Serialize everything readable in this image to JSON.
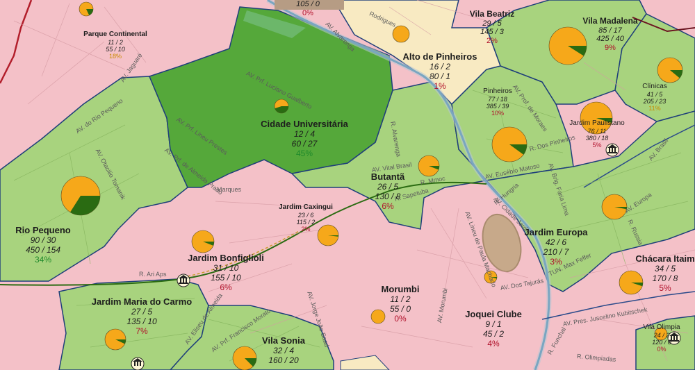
{
  "colors": {
    "pink": "#f4c1c8",
    "light_green": "#a8d37e",
    "dark_green": "#55a83a",
    "cream": "#f8eac2",
    "pie_orange": "#f6a81a",
    "pie_green": "#2a6b12",
    "pct_red": "#b0102a",
    "pct_green": "#1f8a2b",
    "pct_orange": "#c98a00"
  },
  "districts": [
    {
      "name": "Parque Continental",
      "v1": "11 / 2",
      "v2": "55 / 10",
      "pct": "18%",
      "pct_color": "orange"
    },
    {
      "name": "",
      "v1": "105 / 0",
      "v2": "",
      "pct": "0%",
      "pct_color": "red"
    },
    {
      "name": "Vila Beatriz",
      "v1": "29 / 5",
      "v2": "145 / 3",
      "pct": "2%",
      "pct_color": "red"
    },
    {
      "name": "Vila Madalena",
      "v1": "85 / 17",
      "v2": "425 / 40",
      "pct": "9%",
      "pct_color": "red"
    },
    {
      "name": "Alto de Pinheiros",
      "v1": "16 / 2",
      "v2": "80 / 1",
      "pct": "1%",
      "pct_color": "red"
    },
    {
      "name": "Pinheiros",
      "v1": "77 / 18",
      "v2": "385 / 39",
      "pct": "10%",
      "pct_color": "red"
    },
    {
      "name": "Clínicas",
      "v1": "41 / 5",
      "v2": "205 / 23",
      "pct": "11%",
      "pct_color": "orange"
    },
    {
      "name": "Jardim Paulistano",
      "v1": "76 / 11",
      "v2": "380 / 18",
      "pct": "5%",
      "pct_color": "red"
    },
    {
      "name": "Cidade Universitária",
      "v1": "12 / 4",
      "v2": "60 / 27",
      "pct": "45%",
      "pct_color": "green"
    },
    {
      "name": "Butantã",
      "v1": "26 / 5",
      "v2": "130 / 8",
      "pct": "6%",
      "pct_color": "red"
    },
    {
      "name": "Rio Pequeno",
      "v1": "90 / 30",
      "v2": "450 / 154",
      "pct": "34%",
      "pct_color": "green"
    },
    {
      "name": "Jardim Caxingui",
      "v1": "23 / 6",
      "v2": "115 / 2",
      "pct": "2%",
      "pct_color": "red"
    },
    {
      "name": "Jardim Bonfiglioli",
      "v1": "31 / 10",
      "v2": "155 / 10",
      "pct": "6%",
      "pct_color": "red"
    },
    {
      "name": "Jardim Europa",
      "v1": "42 / 6",
      "v2": "210 / 7",
      "pct": "3%",
      "pct_color": "red"
    },
    {
      "name": "Chácara Itaim",
      "v1": "34 / 5",
      "v2": "170 / 8",
      "pct": "5%",
      "pct_color": "red"
    },
    {
      "name": "Jardim Maria do Carmo",
      "v1": "27 / 5",
      "v2": "135 / 10",
      "pct": "7%",
      "pct_color": "red"
    },
    {
      "name": "Morumbi",
      "v1": "11 / 2",
      "v2": "55 / 0",
      "pct": "0%",
      "pct_color": "red"
    },
    {
      "name": "Joquei Clube",
      "v1": "9 / 1",
      "v2": "45 / 2",
      "pct": "4%",
      "pct_color": "red"
    },
    {
      "name": "Vila Sonia",
      "v1": "32 / 4",
      "v2": "160 / 20",
      "pct": "",
      "pct_color": "red"
    },
    {
      "name": "Vila Olimpia",
      "v1": "24 / 2",
      "v2": "120 / 0",
      "pct": "0%",
      "pct_color": "red"
    }
  ],
  "pies": [
    {
      "share": 0.18,
      "label": "parque-continental"
    },
    {
      "share": 0.0,
      "label": "alto-de-pinheiros"
    },
    {
      "share": 0.09,
      "label": "vila-madalena"
    },
    {
      "share": 0.11,
      "label": "clinicas"
    },
    {
      "share": 0.05,
      "label": "jardim-paulistano"
    },
    {
      "share": 0.1,
      "label": "pinheiros"
    },
    {
      "share": 0.45,
      "label": "cidade-universitaria"
    },
    {
      "share": 0.06,
      "label": "butanta"
    },
    {
      "share": 0.34,
      "label": "rio-pequeno"
    },
    {
      "share": 0.02,
      "label": "jardim-caxingui"
    },
    {
      "share": 0.06,
      "label": "jardim-bonfiglioli"
    },
    {
      "share": 0.03,
      "label": "jardim-europa"
    },
    {
      "share": 0.05,
      "label": "chacara-itaim"
    },
    {
      "share": 0.07,
      "label": "jardim-maria-do-carmo"
    },
    {
      "share": 0.0,
      "label": "morumbi"
    },
    {
      "share": 0.04,
      "label": "joquei-clube"
    },
    {
      "share": 0.125,
      "label": "vila-sonia"
    },
    {
      "share": 0.0,
      "label": "vila-olimpia"
    }
  ],
  "streets": [
    "AV. Jaguaré",
    "AV. Alvarenga",
    "Rodrigues",
    "AV. Prf. Luciano Gualberto",
    "AV. Prf. Lineu Prestes",
    "AV. Prf. de Almeida Prado",
    "Marques",
    "AV. do Rio Pequeno",
    "AV. Otacilio Tomanik",
    "R. Alvarenga",
    "AV. Vital Brasil",
    "R. Mmoc",
    "R. Sapetuba",
    "AV. Eusébio Matoso",
    "R. Hungria",
    "AV. Cidade Jardim",
    "AV. Lineu de Paula Machado",
    "AV. Brig. Faria Lima",
    "AV. Europa",
    "AV. Brasil",
    "R. Dos Pinheiros",
    "AV. Prof. de Moraes",
    "R. Russia",
    "R. Ari Aps",
    "AV. Eliseu de Almeida",
    "AV. Prf. Francisco Morato",
    "AV. Jorge João Saad",
    "AV. Morumbi",
    "AV. Dos Tajurás",
    "AV. Pres. Juscelino Kubitschek",
    "R. Funchal",
    "R. Olimpiadas",
    "TUN. Max Feffer"
  ]
}
